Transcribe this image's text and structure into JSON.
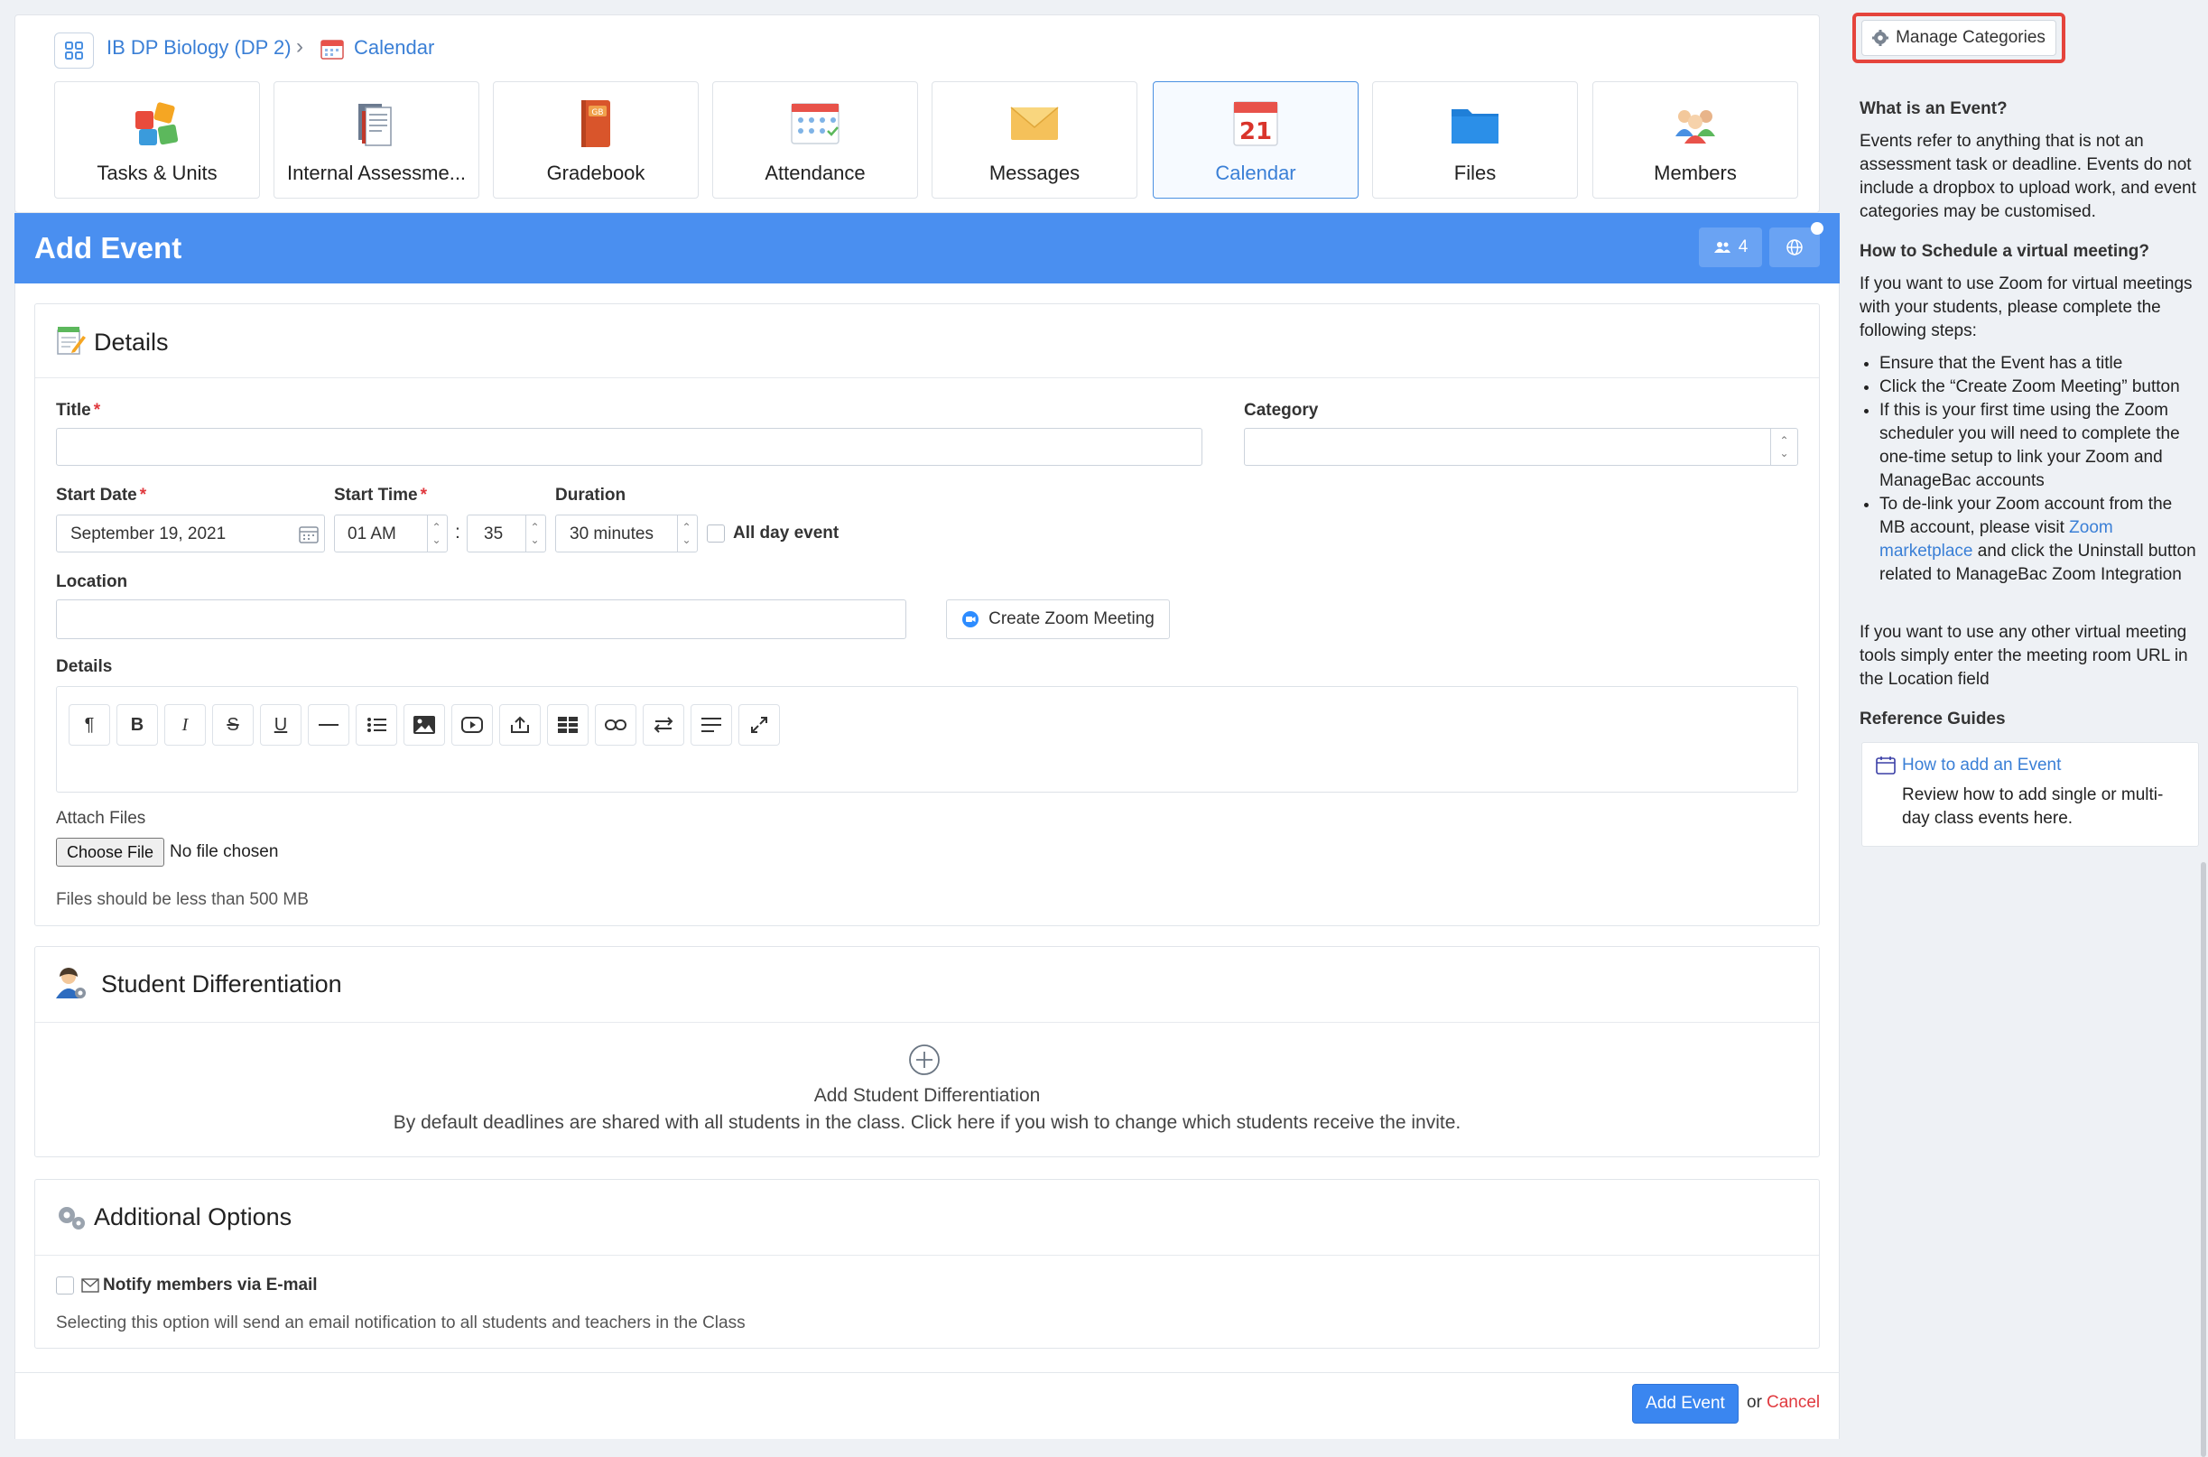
{
  "breadcrumb": {
    "class_name": "IB DP Biology (DP 2)",
    "separator": "›",
    "page": "Calendar"
  },
  "tiles": [
    {
      "label": "Tasks & Units"
    },
    {
      "label": "Internal Assessme..."
    },
    {
      "label": "Gradebook"
    },
    {
      "label": "Attendance"
    },
    {
      "label": "Messages"
    },
    {
      "label": "Calendar"
    },
    {
      "label": "Files"
    },
    {
      "label": "Members"
    }
  ],
  "header": {
    "title": "Add Event",
    "member_count": "4"
  },
  "details": {
    "section_title": "Details",
    "title_label": "Title",
    "required_mark": "*",
    "category_label": "Category",
    "start_date_label": "Start Date",
    "start_date_value": "September 19, 2021",
    "start_time_label": "Start Time",
    "start_hour": "01 AM",
    "time_sep": ":",
    "start_minute": "35",
    "duration_label": "Duration",
    "duration_value": "30 minutes",
    "all_day_label": "All day event",
    "location_label": "Location",
    "zoom_button": "Create Zoom Meeting",
    "details_label": "Details",
    "attach_label": "Attach Files",
    "choose_file": "Choose File",
    "no_file": "No file chosen",
    "file_hint": "Files should be less than 500 MB"
  },
  "differentiation": {
    "section_title": "Student Differentiation",
    "add_title": "Add Student Differentiation",
    "description": "By default deadlines are shared with all students in the class. Click here if you wish to change which students receive the invite."
  },
  "additional": {
    "section_title": "Additional Options",
    "notify_label": "Notify members via E-mail",
    "notify_hint": "Selecting this option will send an email notification to all students and teachers in the Class"
  },
  "footer": {
    "submit": "Add Event",
    "or": "or",
    "cancel": "Cancel"
  },
  "sidebar": {
    "manage_button": "Manage Categories",
    "what_heading": "What is an Event?",
    "what_text": "Events refer to anything that is not an assessment task or deadline. Events do not include a dropbox to upload work, and event categories may be customised.",
    "how_heading": "How to Schedule a virtual meeting?",
    "how_intro": "If you want to use Zoom for virtual meetings with your students, please complete the following steps:",
    "steps": [
      "Ensure that the Event has a title",
      "Click the “Create Zoom Meeting” button",
      "If this is your first time using the Zoom scheduler you will need to complete the one-time setup to link your Zoom and ManageBac accounts"
    ],
    "step4_pre": "To de-link your Zoom account from the MB account, please visit",
    "step4_link": "Zoom marketplace",
    "step4_post": "and click the Uninstall button related to ManageBac Zoom Integration",
    "other_text": "If you want to use any other virtual meeting tools simply enter the meeting room URL in the Location field",
    "ref_heading": "Reference Guides",
    "ref_link": "How to add an Event",
    "ref_desc": "Review how to add single or multi-day class events here."
  },
  "colors": {
    "accent": "#4a8ff0",
    "link": "#3a7fd6",
    "highlight": "#e5443c",
    "cancel": "#e0393e"
  }
}
